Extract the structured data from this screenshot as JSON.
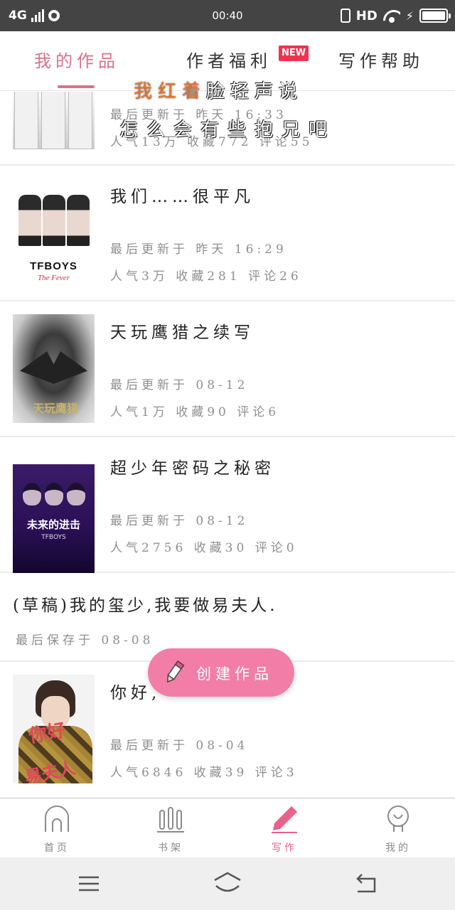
{
  "status_bar": {
    "network": "4G",
    "time": "00:40",
    "hd": "HD"
  },
  "tabs": {
    "items": [
      {
        "label": "我的作品",
        "active": true
      },
      {
        "label": "作者福利",
        "active": false
      },
      {
        "label": "写作帮助",
        "active": false
      }
    ],
    "new_badge": "NEW"
  },
  "overlay_text": {
    "line1_highlight": "我红着",
    "line1_rest": "脸轻声说",
    "line2": "怎么会有些抱兄吧"
  },
  "works": [
    {
      "title": "",
      "meta1": "最后更新于 昨天 16:33",
      "meta2": "人气13万 收藏772 评论55"
    },
    {
      "title": "我们……很平凡",
      "meta1": "最后更新于 昨天 16:29",
      "meta2": "人气3万 收藏281 评论26",
      "cover_brand": "TFBOYS",
      "cover_sub": "The Fever"
    },
    {
      "title": "天玩鹰猎之续写",
      "meta1": "最后更新于 08-12",
      "meta2": "人气1万 收藏90 评论6"
    },
    {
      "title": "超少年密码之秘密",
      "meta1": "最后更新于 08-12",
      "meta2": "人气2756 收藏30 评论0",
      "cover_text": "未来的进击",
      "cover_sub": "TFBOYS"
    },
    {
      "title": "(草稿)我的玺少,我要做易夫人.",
      "meta1": "最后保存于 08-08",
      "is_draft": true
    },
    {
      "title": "你好,",
      "meta1": "最后更新于 08-04",
      "meta2": "人气6846 收藏39 评论3",
      "cover_word1": "你好",
      "cover_word2": "易夫人"
    }
  ],
  "fab": {
    "label": "创建作品",
    "icon": "pencil-icon"
  },
  "bottom_nav": [
    {
      "label": "首页",
      "icon": "home-icon",
      "active": false
    },
    {
      "label": "书架",
      "icon": "bookshelf-icon",
      "active": false
    },
    {
      "label": "写作",
      "icon": "pencil-icon",
      "active": true
    },
    {
      "label": "我的",
      "icon": "profile-icon",
      "active": false
    }
  ],
  "system_nav": [
    "menu-icon",
    "home-icon",
    "back-icon"
  ],
  "colors": {
    "accent": "#d9728c",
    "fab": "#f27ea7",
    "badge": "#f0334f",
    "status_bar": "#444444"
  }
}
